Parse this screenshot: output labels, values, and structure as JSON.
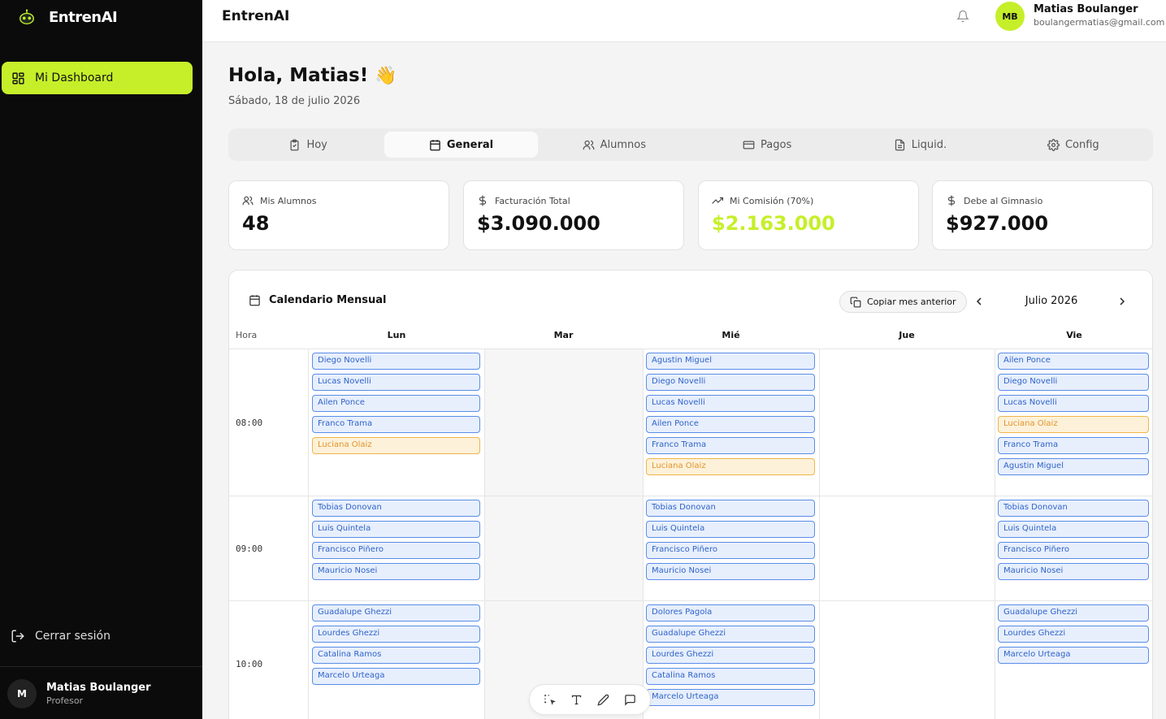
{
  "sidebar": {
    "brand": "EntrenAI",
    "nav_item": "Mi Dashboard",
    "logout": "Cerrar sesión",
    "user": {
      "initial": "M",
      "name": "Matias Boulanger",
      "role": "Profesor"
    }
  },
  "header": {
    "title": "EntrenAI",
    "user": {
      "initials": "MB",
      "name": "Matias Boulanger",
      "email": "boulangermatias@gmail.com"
    }
  },
  "greeting": {
    "text": "Hola, Matias!",
    "emoji": "👋",
    "date": "Sábado, 18 de julio 2026"
  },
  "tabs": [
    {
      "label": "Hoy",
      "icon": "clipboard-icon"
    },
    {
      "label": "General",
      "icon": "calendar-icon"
    },
    {
      "label": "Alumnos",
      "icon": "users-icon"
    },
    {
      "label": "Pagos",
      "icon": "card-icon"
    },
    {
      "label": "Liquid.",
      "icon": "document-icon"
    },
    {
      "label": "Config",
      "icon": "gear-icon"
    }
  ],
  "stats": [
    {
      "label": "Mis Alumnos",
      "value": "48",
      "icon": "users-icon"
    },
    {
      "label": "Facturación Total",
      "value": "$3.090.000",
      "icon": "dollar-icon"
    },
    {
      "label": "Mi Comisión (70%)",
      "value": "$2.163.000",
      "icon": "trend-up-icon",
      "accent": "#c6ef2a"
    },
    {
      "label": "Debe al Gimnasio",
      "value": "$927.000",
      "icon": "dollar-icon"
    }
  ],
  "calendar": {
    "title": "Calendario Mensual",
    "copy_button": "Copiar mes anterior",
    "month": "Julio 2026",
    "hora_label": "Hora",
    "days": [
      "Lun",
      "Mar",
      "Mié",
      "Jue",
      "Vie"
    ],
    "times": [
      "08:00",
      "09:00",
      "10:00"
    ],
    "slots": {
      "lun": [
        [
          "Diego Novelli",
          "Lucas Novelli",
          "Ailen Ponce",
          "Franco Trama",
          "Luciana Olaiz"
        ],
        [
          "Tobias Donovan",
          "Luis Quintela",
          "Francisco Piñero",
          "Mauricio Nosei"
        ],
        [
          "Guadalupe Ghezzi",
          "Lourdes Ghezzi",
          "Catalina Ramos",
          "Marcelo Urteaga"
        ]
      ],
      "mie": [
        [
          "Agustin Miguel",
          "Diego Novelli",
          "Lucas Novelli",
          "Ailen Ponce",
          "Franco Trama",
          "Luciana Olaiz"
        ],
        [
          "Tobias Donovan",
          "Luis Quintela",
          "Francisco Piñero",
          "Mauricio Nosei"
        ],
        [
          "Dolores Pagola",
          "Guadalupe Ghezzi",
          "Lourdes Ghezzi",
          "Catalina Ramos",
          "Marcelo Urteaga"
        ]
      ],
      "vie": [
        [
          "Ailen Ponce",
          "Diego Novelli",
          "Lucas Novelli",
          "Luciana Olaiz",
          "Franco Trama",
          "Agustin Miguel"
        ],
        [
          "Tobias Donovan",
          "Luis Quintela",
          "Francisco Piñero",
          "Mauricio Nosei"
        ],
        [
          "Guadalupe Ghezzi",
          "Lourdes Ghezzi",
          "Marcelo Urteaga"
        ]
      ]
    },
    "highlighted": [
      "Luciana Olaiz"
    ]
  },
  "colors": {
    "accent": "#c6ef2a",
    "slot_blue": "#5a8de6",
    "slot_warn": "#f0b54a"
  }
}
